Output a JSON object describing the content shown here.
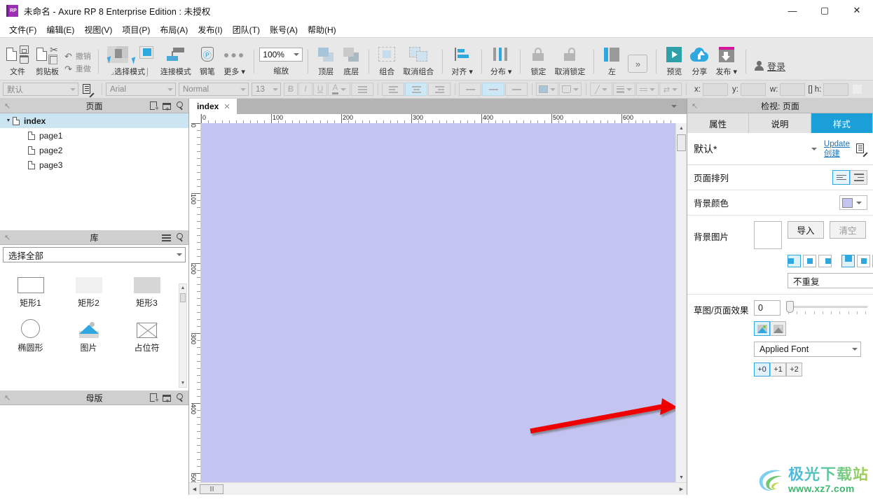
{
  "window": {
    "title": "未命名 - Axure RP 8 Enterprise Edition : 未授权",
    "logo_text": "RP",
    "minimize": "—",
    "maximize": "▢",
    "close": "✕"
  },
  "menubar": {
    "items": [
      {
        "label": "文件(F)"
      },
      {
        "label": "编辑(E)"
      },
      {
        "label": "视图(V)"
      },
      {
        "label": "项目(P)"
      },
      {
        "label": "布局(A)"
      },
      {
        "label": "发布(I)"
      },
      {
        "label": "团队(T)"
      },
      {
        "label": "账号(A)"
      },
      {
        "label": "帮助(H)"
      }
    ]
  },
  "toolbar": {
    "file_label": "文件",
    "clipboard_label": "剪贴板",
    "undo_label": "撤销",
    "redo_label": "重做",
    "select_mode_label": "选择模式",
    "connect_mode_label": "连接模式",
    "pen_label": "钢笔",
    "more_label": "更多 ▾",
    "zoom_value": "100%",
    "zoom_label": "缩放",
    "front_label": "顶层",
    "back_label": "底层",
    "group_label": "组合",
    "ungroup_label": "取消组合",
    "align_label": "对齐 ▾",
    "distribute_label": "分布 ▾",
    "lock_label": "锁定",
    "unlock_label": "取消锁定",
    "left_label": "左",
    "overflow_label": "»",
    "preview_label": "预览",
    "share_label": "分享",
    "publish_label": "发布 ▾",
    "login_label": "登录"
  },
  "formatbar": {
    "style_value": "默认",
    "font_value": "Arial",
    "weight_value": "Normal",
    "size_value": "13",
    "bold": "B",
    "italic": "I",
    "underline": "U",
    "text_color": "A",
    "bullets": "≔",
    "align_left": "≡",
    "align_center": "≡",
    "align_right": "≡",
    "valign_top": "⎺",
    "valign_mid": "⎼",
    "valign_bot": "⎽",
    "x_label": "x:",
    "y_label": "y:",
    "w_label": "w:",
    "h_label": "h:",
    "lock_ratio_icon": "link-icon",
    "x_value": "",
    "y_value": "",
    "w_value": "",
    "h_value": ""
  },
  "pages_panel": {
    "title": "页面",
    "add_page_icon": "add-page-icon",
    "add_folder_icon": "add-folder-icon",
    "search_icon": "search-icon",
    "tree": [
      {
        "label": "index",
        "level": 0,
        "selected": true,
        "expander": "▼"
      },
      {
        "label": "page1",
        "level": 1,
        "selected": false
      },
      {
        "label": "page2",
        "level": 1,
        "selected": false
      },
      {
        "label": "page3",
        "level": 1,
        "selected": false
      }
    ]
  },
  "library_panel": {
    "title": "库",
    "menu_icon": "hamburger-icon",
    "search_icon": "search-icon",
    "filter_value": "选择全部",
    "items": [
      {
        "label": "矩形1",
        "thumb": "rect-outline"
      },
      {
        "label": "矩形2",
        "thumb": "rect-light"
      },
      {
        "label": "矩形3",
        "thumb": "rect-gray"
      },
      {
        "label": "椭圆形",
        "thumb": "ellipse"
      },
      {
        "label": "图片",
        "thumb": "image"
      },
      {
        "label": "占位符",
        "thumb": "placeholder"
      }
    ]
  },
  "masters_panel": {
    "title": "母版",
    "add_master_icon": "add-page-icon",
    "add_folder_icon": "add-folder-icon",
    "search_icon": "search-icon"
  },
  "canvas": {
    "tab_label": "index",
    "tab_close": "✕",
    "tab_dropdown_icon": "chevron-down-icon",
    "h_ruler_labels": [
      "0",
      "100",
      "200",
      "300",
      "400",
      "500",
      "600"
    ],
    "v_ruler_labels": [
      "0",
      "100",
      "200",
      "300",
      "400",
      "500"
    ],
    "page_background_color": "#c4c4f0",
    "annotation": {
      "type": "red-arrow",
      "color": "#ee0000",
      "direction": "points-right"
    }
  },
  "inspector": {
    "title": "检视: 页面",
    "tabs": [
      {
        "label": "属性",
        "active": false
      },
      {
        "label": "说明",
        "active": false
      },
      {
        "label": "样式",
        "active": true
      }
    ],
    "style_name": "默认*",
    "update_link": "Update",
    "create_link": "创建",
    "edit_icon": "style-edit-icon",
    "page_align": {
      "label": "页面排列",
      "options": [
        "left-align",
        "center-align"
      ],
      "selected": 0
    },
    "background_color": {
      "label": "背景颜色",
      "value": "#c4c4f0"
    },
    "background_image": {
      "label": "背景图片",
      "import_button": "导入",
      "clear_button": "清空",
      "h_align": [
        "left",
        "center",
        "right"
      ],
      "h_selected": 0,
      "v_align": [
        "top",
        "middle",
        "bottom"
      ],
      "v_selected": 0,
      "repeat_value": "不重复"
    },
    "sketch": {
      "label": "草图/页面效果",
      "value": "0",
      "color_mode_icons": [
        "color-image-icon",
        "gray-image-icon"
      ],
      "color_mode_selected": 0,
      "font_value": "Applied Font",
      "font_size_steps": [
        "+0",
        "+1",
        "+2"
      ],
      "font_size_selected": 0
    }
  },
  "watermark": {
    "line1": "极光下载站",
    "line2": "www.xz7.com"
  }
}
